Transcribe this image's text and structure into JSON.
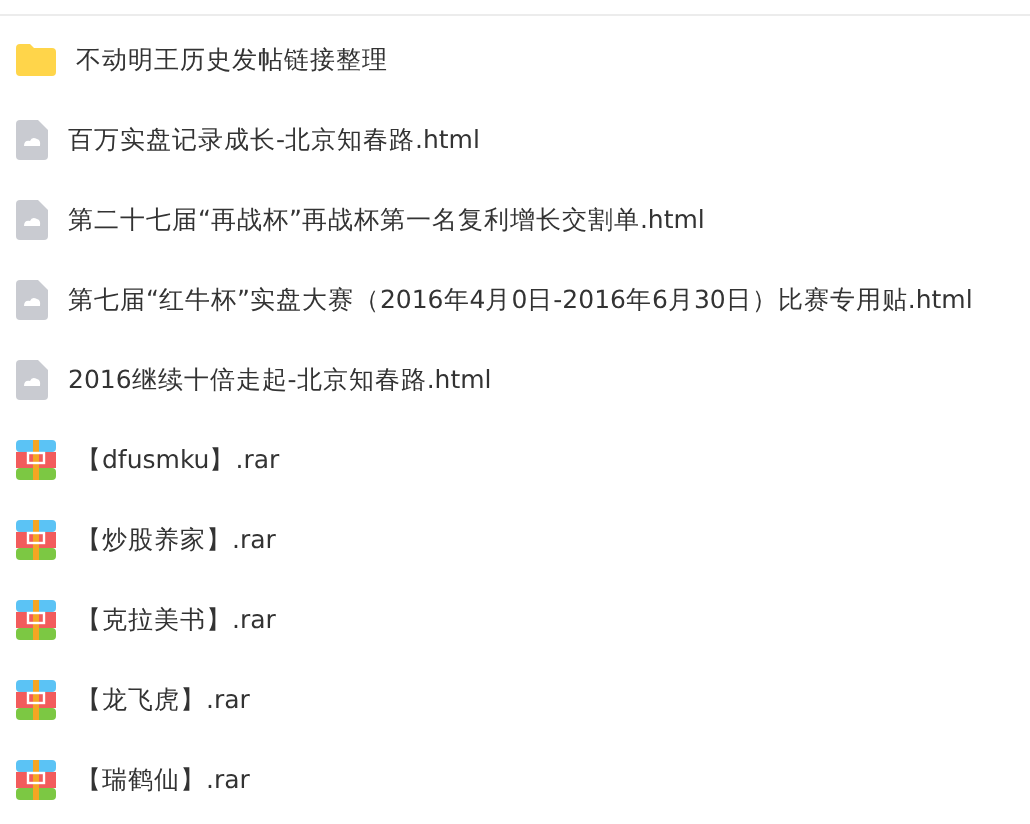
{
  "files": [
    {
      "kind": "folder",
      "name": "不动明王历史发帖链接整理"
    },
    {
      "kind": "html",
      "name": "百万实盘记录成长-北京知春路.html"
    },
    {
      "kind": "html",
      "name": "第二十七届“再战杯”再战杯第一名复利增长交割单.html"
    },
    {
      "kind": "html",
      "name": "第七届“红牛杯”实盘大赛（2016年4月0日-2016年6月30日）比赛专用贴.html"
    },
    {
      "kind": "html",
      "name": "2016继续十倍走起-北京知春路.html"
    },
    {
      "kind": "rar",
      "name": "【dfusmku】.rar"
    },
    {
      "kind": "rar",
      "name": "【炒股养家】.rar"
    },
    {
      "kind": "rar",
      "name": "【克拉美书】.rar"
    },
    {
      "kind": "rar",
      "name": "【龙飞虎】.rar"
    },
    {
      "kind": "rar",
      "name": "【瑞鹤仙】.rar"
    }
  ]
}
